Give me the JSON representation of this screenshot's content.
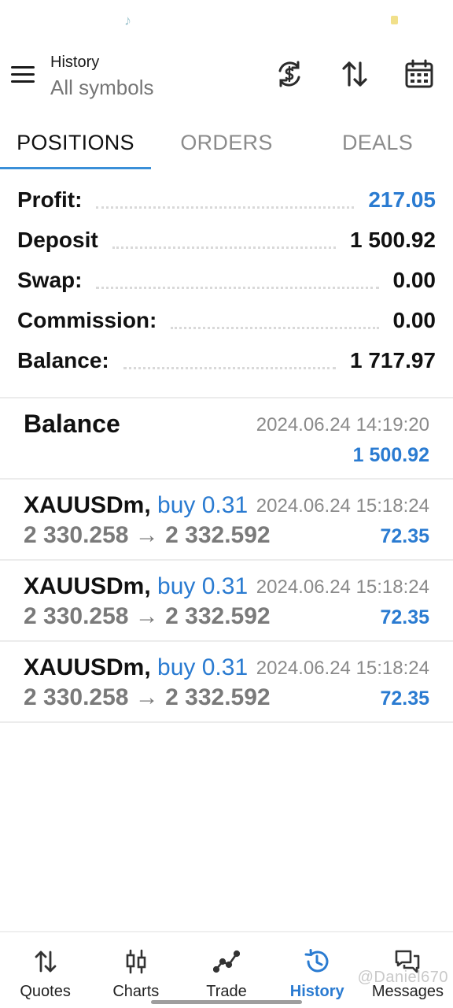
{
  "header": {
    "title": "History",
    "subtitle": "All symbols",
    "icons": [
      "currency-exchange-icon",
      "sort-icon",
      "calendar-icon"
    ]
  },
  "tabs": [
    {
      "label": "POSITIONS",
      "active": true
    },
    {
      "label": "ORDERS",
      "active": false
    },
    {
      "label": "DEALS",
      "active": false
    }
  ],
  "summary": {
    "profit_label": "Profit:",
    "profit_value": "217.05",
    "deposit_label": "Deposit",
    "deposit_value": "1 500.92",
    "swap_label": "Swap:",
    "swap_value": "0.00",
    "commission_label": "Commission:",
    "commission_value": "0.00",
    "balance_label": "Balance:",
    "balance_value": "1 717.97"
  },
  "balance_entry": {
    "title": "Balance",
    "time": "2024.06.24 14:19:20",
    "amount": "1 500.92"
  },
  "positions": [
    {
      "symbol": "XAUUSDm,",
      "type": "buy 0.31",
      "time": "2024.06.24 15:18:24",
      "prices": "2 330.258 → 2 332.592",
      "profit": "72.35"
    },
    {
      "symbol": "XAUUSDm,",
      "type": "buy 0.31",
      "time": "2024.06.24 15:18:24",
      "prices": "2 330.258 → 2 332.592",
      "profit": "72.35"
    },
    {
      "symbol": "XAUUSDm,",
      "type": "buy 0.31",
      "time": "2024.06.24 15:18:24",
      "prices": "2 330.258 → 2 332.592",
      "profit": "72.35"
    }
  ],
  "bottom_nav": [
    {
      "label": "Quotes",
      "icon": "quotes-icon",
      "active": false
    },
    {
      "label": "Charts",
      "icon": "charts-icon",
      "active": false
    },
    {
      "label": "Trade",
      "icon": "trade-icon",
      "active": false
    },
    {
      "label": "History",
      "icon": "history-icon",
      "active": true
    },
    {
      "label": "Messages",
      "icon": "messages-icon",
      "active": false
    }
  ],
  "watermark": "@Daniel670",
  "colors": {
    "accent": "#2a7bd1",
    "muted": "#8a8a8a"
  }
}
